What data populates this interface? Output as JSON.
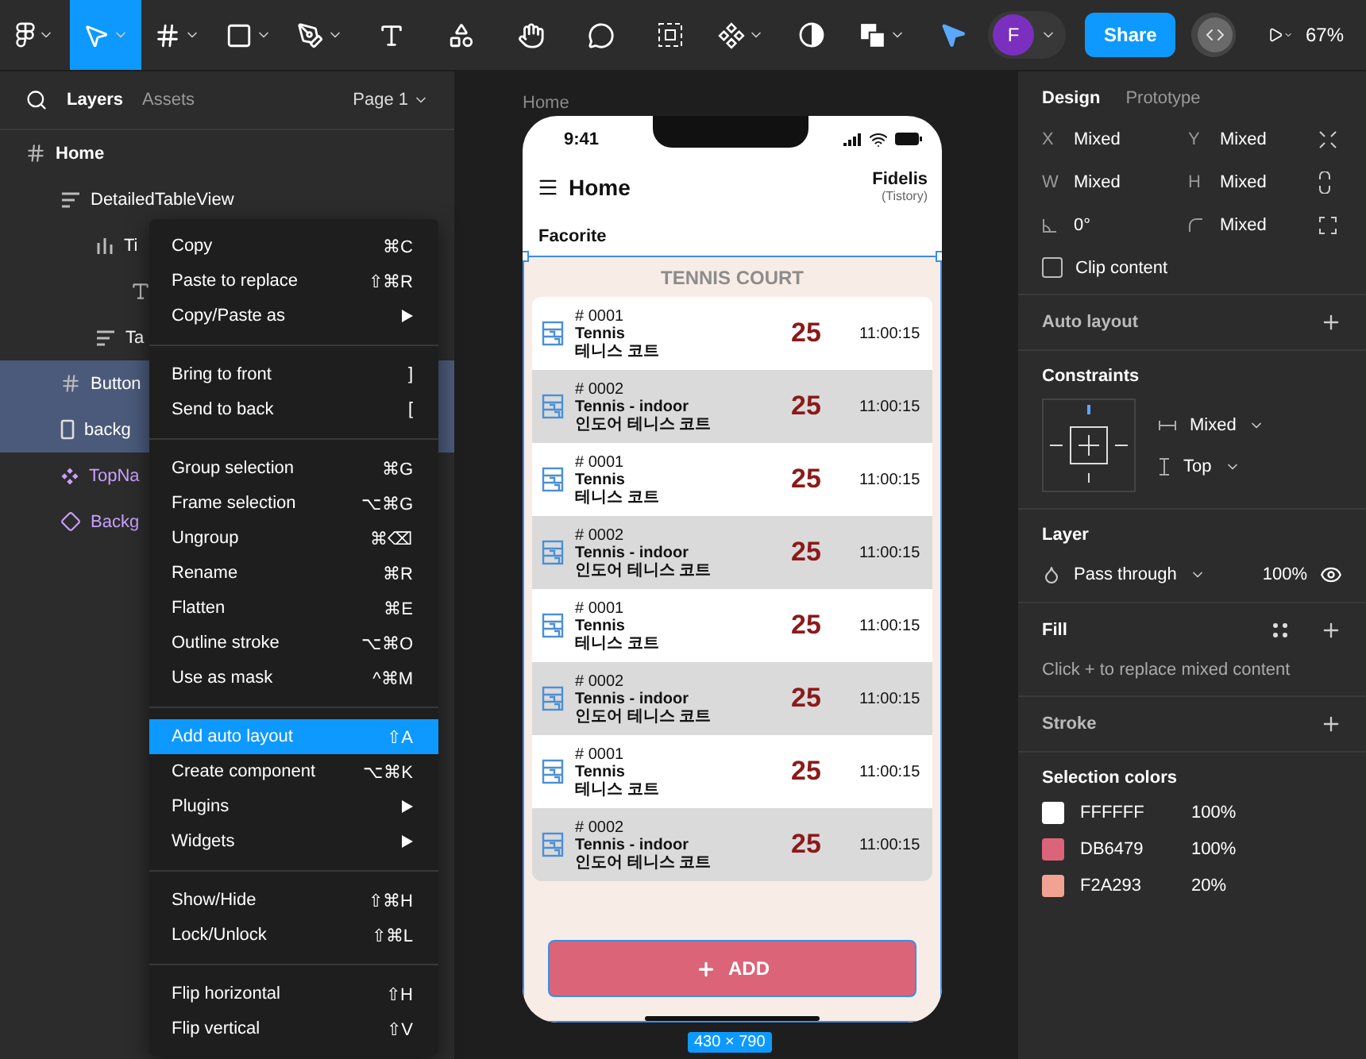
{
  "toolbar": {
    "left_tools": [
      {
        "kind": "logo",
        "selected": false,
        "has_menu": true
      },
      {
        "kind": "move",
        "selected": true,
        "has_menu": true
      },
      {
        "kind": "frame",
        "selected": false,
        "has_menu": true
      },
      {
        "kind": "shape",
        "selected": false,
        "has_menu": true
      },
      {
        "kind": "pen",
        "selected": false,
        "has_menu": true
      },
      {
        "kind": "text",
        "selected": false,
        "has_menu": false
      },
      {
        "kind": "resources",
        "selected": false,
        "has_menu": false
      },
      {
        "kind": "hand",
        "selected": false,
        "has_menu": false
      },
      {
        "kind": "comment",
        "selected": false,
        "has_menu": false
      }
    ],
    "center_tools": [
      {
        "kind": "mask",
        "selected": false,
        "has_menu": false
      },
      {
        "kind": "component",
        "selected": false,
        "has_menu": true
      },
      {
        "kind": "contrast",
        "selected": false,
        "has_menu": false
      },
      {
        "kind": "boolean",
        "selected": false,
        "has_menu": true
      }
    ],
    "avatar": "F",
    "share": "Share",
    "zoom": "67%"
  },
  "left_panel": {
    "tabs": [
      {
        "label": "Layers",
        "selected": true
      },
      {
        "label": "Assets",
        "selected": false
      }
    ],
    "page": "Page 1",
    "layers": [
      {
        "kind": "frame",
        "label": "Home",
        "selected": false,
        "children": [
          {
            "kind": "stack",
            "label": "DetailedTableView",
            "selected": false,
            "children": [
              {
                "kind": "columns",
                "label": "Ti",
                "selected": false,
                "children": [
                  {
                    "kind": "text",
                    "selected": false
                  }
                ]
              },
              {
                "kind": "stack",
                "label": "Ta",
                "selected": false
              }
            ]
          },
          {
            "kind": "frame",
            "label": "Button",
            "selected": true
          },
          {
            "kind": "rectangle",
            "label": "backg",
            "selected": true
          },
          {
            "kind": "component",
            "label": "TopNa",
            "selected": false
          },
          {
            "kind": "instance",
            "label": "Backg",
            "selected": false
          }
        ]
      }
    ]
  },
  "context_menu": {
    "groups": [
      [
        {
          "label": "Copy",
          "shortcut": "⌘C",
          "selected": false
        },
        {
          "label": "Paste to replace",
          "shortcut": "⇧⌘R",
          "selected": false
        },
        {
          "label": "Copy/Paste as",
          "submenu": true,
          "selected": false
        }
      ],
      [
        {
          "label": "Bring to front",
          "shortcut": "]",
          "selected": false
        },
        {
          "label": "Send to back",
          "shortcut": "[",
          "selected": false
        }
      ],
      [
        {
          "label": "Group selection",
          "shortcut": "⌘G",
          "selected": false
        },
        {
          "label": "Frame selection",
          "shortcut": "⌥⌘G",
          "selected": false
        },
        {
          "label": "Ungroup",
          "shortcut": "⌘⌫",
          "selected": false
        },
        {
          "label": "Rename",
          "shortcut": "⌘R",
          "selected": false
        },
        {
          "label": "Flatten",
          "shortcut": "⌘E",
          "selected": false
        },
        {
          "label": "Outline stroke",
          "shortcut": "⌥⌘O",
          "selected": false
        },
        {
          "label": "Use as mask",
          "shortcut": "^⌘M",
          "selected": false
        }
      ],
      [
        {
          "label": "Add auto layout",
          "shortcut": "⇧A",
          "selected": true
        },
        {
          "label": "Create component",
          "shortcut": "⌥⌘K",
          "selected": false
        },
        {
          "label": "Plugins",
          "submenu": true,
          "selected": false
        },
        {
          "label": "Widgets",
          "submenu": true,
          "selected": false
        }
      ],
      [
        {
          "label": "Show/Hide",
          "shortcut": "⇧⌘H",
          "selected": false
        },
        {
          "label": "Lock/Unlock",
          "shortcut": "⇧⌘L",
          "selected": false
        }
      ],
      [
        {
          "label": "Flip horizontal",
          "shortcut": "⇧H",
          "selected": false
        },
        {
          "label": "Flip vertical",
          "shortcut": "⇧V",
          "selected": false
        }
      ]
    ]
  },
  "canvas": {
    "frame_label": "Home",
    "size_badge": "430 × 790",
    "phone": {
      "time": "9:41",
      "title": "Home",
      "brand": "Fidelis",
      "brand_sub": "(Tistory)",
      "section": "Facorite",
      "list_title": "TENNIS COURT",
      "rows": [
        {
          "number": "# 0001",
          "name": "Tennis",
          "name_ko": "테니스 코트",
          "count": "25",
          "time": "11:00:15",
          "shaded": false
        },
        {
          "number": "# 0002",
          "name": "Tennis - indoor",
          "name_ko": "인도어 테니스 코트",
          "count": "25",
          "time": "11:00:15",
          "shaded": true
        },
        {
          "number": "# 0001",
          "name": "Tennis",
          "name_ko": "테니스 코트",
          "count": "25",
          "time": "11:00:15",
          "shaded": false
        },
        {
          "number": "# 0002",
          "name": "Tennis - indoor",
          "name_ko": "인도어 테니스 코트",
          "count": "25",
          "time": "11:00:15",
          "shaded": true
        },
        {
          "number": "# 0001",
          "name": "Tennis",
          "name_ko": "테니스 코트",
          "count": "25",
          "time": "11:00:15",
          "shaded": false
        },
        {
          "number": "# 0002",
          "name": "Tennis - indoor",
          "name_ko": "인도어 테니스 코트",
          "count": "25",
          "time": "11:00:15",
          "shaded": true
        },
        {
          "number": "# 0001",
          "name": "Tennis",
          "name_ko": "테니스 코트",
          "count": "25",
          "time": "11:00:15",
          "shaded": false
        },
        {
          "number": "# 0002",
          "name": "Tennis - indoor",
          "name_ko": "인도어 테니스 코트",
          "count": "25",
          "time": "11:00:15",
          "shaded": true
        }
      ],
      "add_button": "ADD"
    }
  },
  "right_panel": {
    "tabs": [
      {
        "label": "Design",
        "selected": true
      },
      {
        "label": "Prototype",
        "selected": false
      }
    ],
    "fields": [
      {
        "kind": "label",
        "label": "X",
        "value": "Mixed"
      },
      {
        "kind": "label",
        "label": "Y",
        "value": "Mixed"
      },
      {
        "kind": "label",
        "label": "W",
        "value": "Mixed"
      },
      {
        "kind": "label",
        "label": "H",
        "value": "Mixed"
      },
      {
        "kind": "rotation",
        "value": "0°"
      },
      {
        "kind": "radius",
        "value": "Mixed"
      }
    ],
    "clip_content": {
      "label": "Clip content",
      "checked": false
    },
    "auto_layout": "Auto layout",
    "constraints": {
      "title": "Constraints",
      "horizontal": "Mixed",
      "vertical": "Top"
    },
    "layer": {
      "title": "Layer",
      "blend": "Pass through",
      "opacity": "100%",
      "visible": true
    },
    "fill": {
      "title": "Fill",
      "hint": "Click + to replace mixed content"
    },
    "stroke": "Stroke",
    "selection_colors": {
      "title": "Selection colors",
      "colors": [
        {
          "hex": "FFFFFF",
          "opacity": "100%",
          "color": "#ffffff"
        },
        {
          "hex": "DB6479",
          "opacity": "100%",
          "color": "#db6479"
        },
        {
          "hex": "F2A293",
          "opacity": "20%",
          "color": "#f2a293"
        }
      ]
    }
  }
}
